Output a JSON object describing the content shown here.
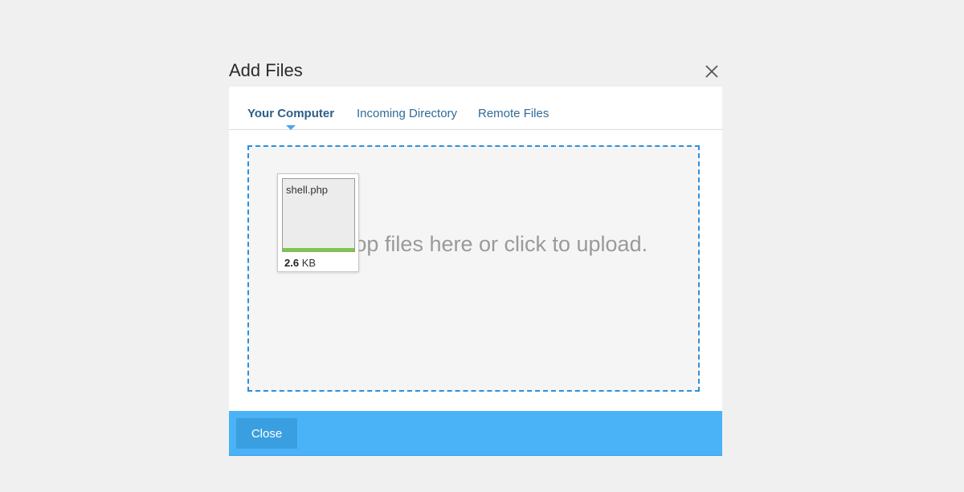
{
  "dialog": {
    "title": "Add Files",
    "close_icon": "close-icon"
  },
  "tabs": [
    {
      "label": "Your Computer",
      "active": true
    },
    {
      "label": "Incoming Directory",
      "active": false
    },
    {
      "label": "Remote Files",
      "active": false
    }
  ],
  "dropzone": {
    "message": "Drop files here or click to upload.",
    "files": [
      {
        "name": "shell.php",
        "size_value": "2.6",
        "size_unit": "KB",
        "progress": 1.0
      }
    ]
  },
  "footer": {
    "close_label": "Close"
  },
  "colors": {
    "accent": "#4ab3f8",
    "tab_text": "#2f6b97",
    "dropzone_border": "#2d8fdb",
    "progress": "#7ac943"
  }
}
